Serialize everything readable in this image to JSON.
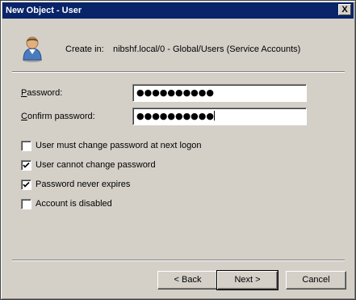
{
  "window": {
    "title": "New Object - User",
    "close_glyph": "X"
  },
  "header": {
    "create_in_label": "Create in:",
    "create_in_value": "nibshf.local/0 - Global/Users (Service Accounts)"
  },
  "form": {
    "password_label": "Password:",
    "password_value": "●●●●●●●●●●",
    "confirm_label": "Confirm password:",
    "confirm_value": "●●●●●●●●●●"
  },
  "options": [
    {
      "label": "User must change password at next logon",
      "checked": false
    },
    {
      "label": "User cannot change password",
      "checked": true
    },
    {
      "label": "Password never expires",
      "checked": true
    },
    {
      "label": "Account is disabled",
      "checked": false
    }
  ],
  "buttons": {
    "back": "< Back",
    "next": "Next >",
    "cancel": "Cancel"
  },
  "colors": {
    "titlebar": "#0a246a",
    "face": "#d4d0c8"
  }
}
